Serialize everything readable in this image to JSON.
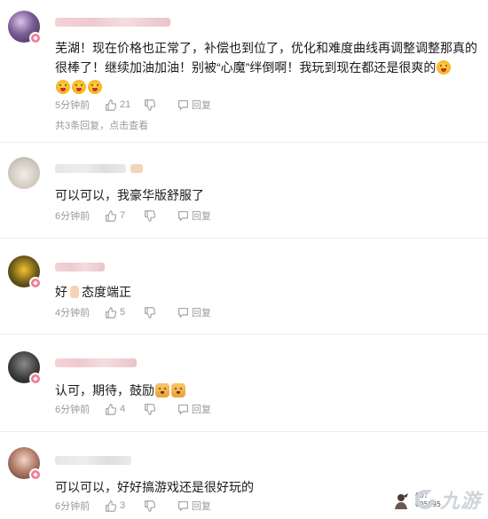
{
  "comments": [
    {
      "text_lines": [
        "芜湖！现在价格也正常了，补偿也到位了，优化和难度曲线再调整调整那真的",
        "很棒了！继续加油加油！别被“心魔”绊倒啊！我玩到现在都还是很爽的"
      ],
      "time": "5分钟前",
      "likes": "21",
      "reply_label": "回复",
      "replies_summary": "共3条回复，点击查看",
      "avatar_color": "#4a3a5c"
    },
    {
      "text": "可以可以，我豪华版舒服了",
      "time": "6分钟前",
      "likes": "7",
      "reply_label": "回复",
      "avatar_color": "#c8c2b8"
    },
    {
      "text_before": "好",
      "text_after": "态度端正",
      "time": "4分钟前",
      "likes": "5",
      "reply_label": "回复",
      "avatar_color": "#2b2a20"
    },
    {
      "text": "认可，期待，鼓励",
      "time": "6分钟前",
      "likes": "4",
      "reply_label": "回复",
      "avatar_color": "#3a3a3a"
    },
    {
      "text": "可以可以，好好搞游戏还是很好玩的",
      "time": "6分钟前",
      "likes": "3",
      "reply_label": "回复",
      "avatar_color": "#8e5d4f"
    }
  ],
  "side_badge": {
    "line1": "CO.",
    "line2": "005995"
  },
  "watermark": {
    "text": "九游"
  },
  "colors": {
    "meta_gray": "#9a9a9a",
    "badge_pink": "#f07c97",
    "name_blur_pink": "#efc9cf"
  }
}
